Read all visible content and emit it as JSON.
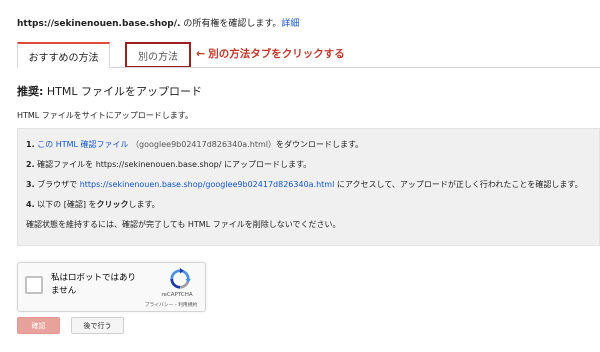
{
  "intro": {
    "domain": "https://sekinenouen.base.shop/.",
    "text": " の所有権を確認します。",
    "details_link": "詳細"
  },
  "tabs": {
    "recommended_label": "おすすめの方法",
    "alternate_label": "別の方法"
  },
  "annotation": {
    "arrow": "←",
    "text": "別の方法タブをクリックする",
    "color": "#c0392b"
  },
  "heading": {
    "prefix": "推奨:",
    "text": " HTML ファイルをアップロード"
  },
  "subtext": "HTML ファイルをサイトにアップロードします。",
  "steps": {
    "step1": {
      "num": "1.",
      "link": "この HTML 確認ファイル",
      "filename": "（googlee9b02417d826340a.html）",
      "text": "をダウンロードします。"
    },
    "step2": {
      "num": "2.",
      "text": "確認ファイルを https://sekinenouen.base.shop/ にアップロードします。"
    },
    "step3": {
      "num": "3.",
      "prefix": "ブラウザで",
      "link": "https://sekinenouen.base.shop/googlee9b02417d826340a.html",
      "suffix": "にアクセスして、アップロードが正しく行われたことを確認します。"
    },
    "step4": {
      "num": "4.",
      "prefix": "以下の [確認] を",
      "bold": "クリック",
      "suffix": "します。"
    },
    "note": "確認状態を維持するには、確認が完了しても HTML ファイルを削除しないでください。"
  },
  "captcha": {
    "label": "私はロボットではありません",
    "brand": "reCAPTCHA",
    "links": "プライバシー - 利用規約",
    "logo_icon": "recaptcha-logo-icon"
  },
  "buttons": {
    "confirm": "確認",
    "later": "後で行う"
  },
  "colors": {
    "accent": "#dd4b39",
    "link": "#1155cc",
    "annotation_box": "#9e1f20",
    "confirm_bg": "#e8a29c"
  }
}
